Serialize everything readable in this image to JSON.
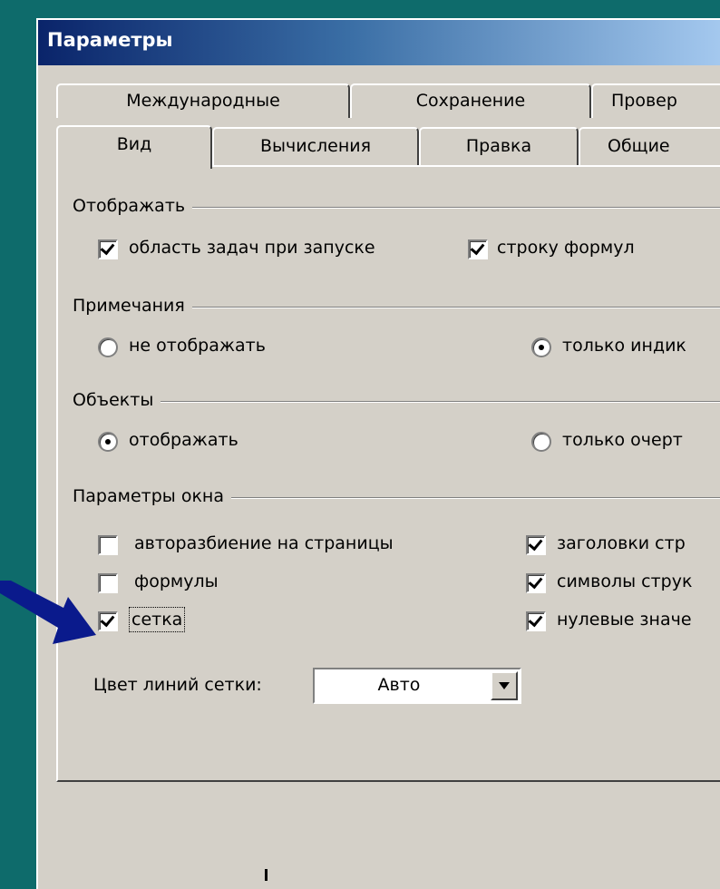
{
  "window": {
    "title": "Параметры"
  },
  "tabs_back": [
    "Международные",
    "Сохранение",
    "Провер"
  ],
  "tabs_front": [
    "Вид",
    "Вычисления",
    "Правка",
    "Общие"
  ],
  "active_tab": "Вид",
  "groups": {
    "display": "Отображать",
    "comments": "Примечания",
    "objects": "Объекты",
    "window_options": "Параметры окна"
  },
  "options": {
    "task_pane": {
      "label": "область задач при запуске",
      "checked": true
    },
    "formula_bar": {
      "label": "строку формул",
      "checked": true
    },
    "comments_none": {
      "label": "не отображать",
      "selected": false
    },
    "comments_indicator": {
      "label": "только индик",
      "selected": true
    },
    "objects_show": {
      "label": "отображать",
      "selected": true
    },
    "objects_outline": {
      "label": "только очерт",
      "selected": false
    },
    "page_breaks": {
      "label": "авторазбиение на страницы",
      "checked": false
    },
    "formulas": {
      "label": "формулы",
      "checked": false
    },
    "gridlines": {
      "label": "сетка",
      "checked": true
    },
    "row_col_headers": {
      "label": "заголовки стр",
      "checked": true
    },
    "outline_symbols": {
      "label": "символы струк",
      "checked": true
    },
    "zero_values": {
      "label": "нулевые значе",
      "checked": true
    }
  },
  "gridline_color": {
    "label": "Цвет линий сетки:",
    "value": "Авто"
  },
  "colors": {
    "background": "#0e6b6b",
    "dialog": "#d4d0c8",
    "arrow": "#0a1a8c"
  }
}
